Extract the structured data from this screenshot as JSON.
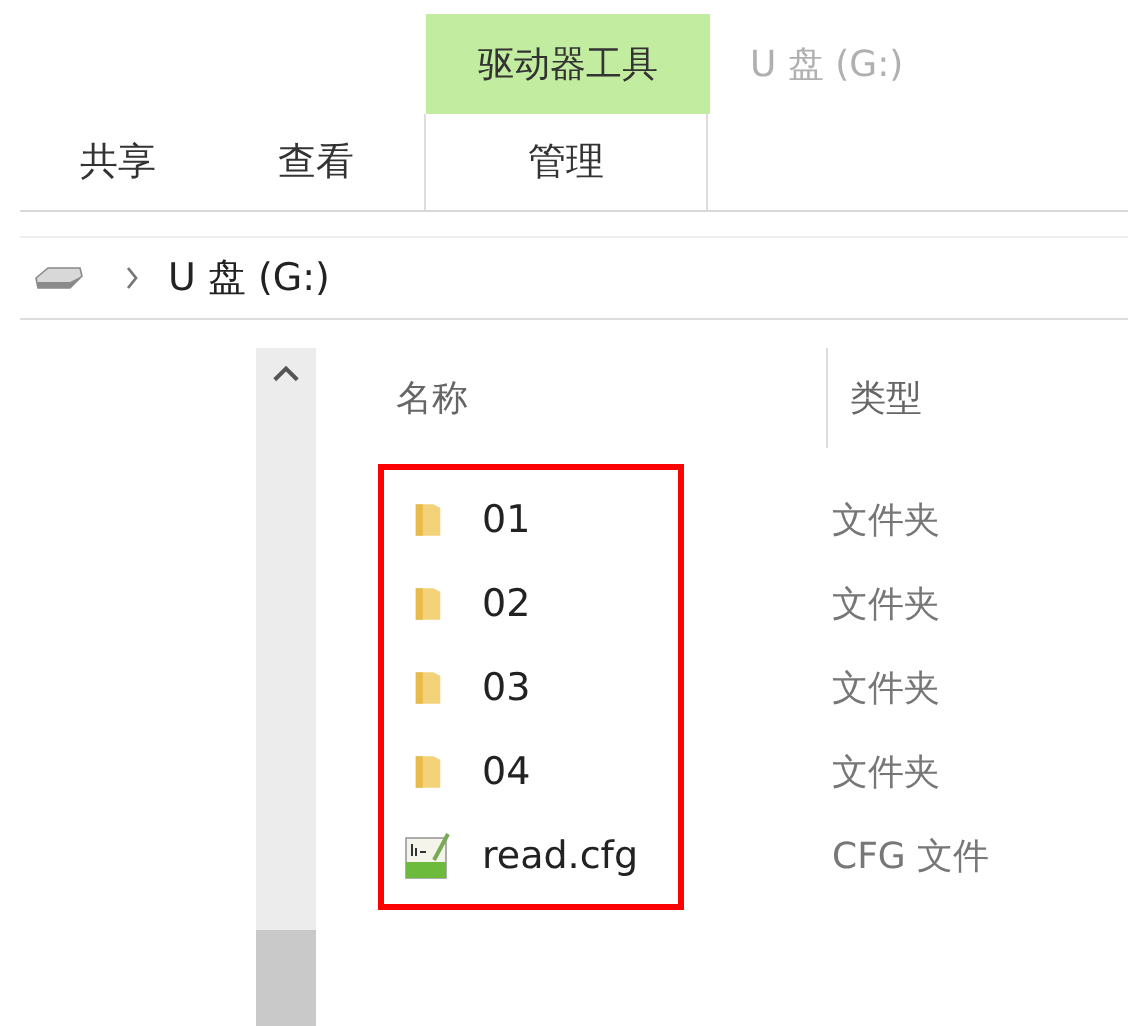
{
  "ribbon": {
    "context_group": "驱动器工具",
    "window_title": "U 盘 (G:)",
    "tabs": [
      {
        "label": "共享",
        "kind": "normal"
      },
      {
        "label": "查看",
        "kind": "normal"
      },
      {
        "label": "管理",
        "kind": "contextual"
      }
    ]
  },
  "address_bar": {
    "path": "U 盘 (G:)"
  },
  "columns": [
    "名称",
    "类型"
  ],
  "files": [
    {
      "name": "01",
      "type": "文件夹",
      "kind": "folder"
    },
    {
      "name": "02",
      "type": "文件夹",
      "kind": "folder"
    },
    {
      "name": "03",
      "type": "文件夹",
      "kind": "folder"
    },
    {
      "name": "04",
      "type": "文件夹",
      "kind": "folder"
    },
    {
      "name": "read.cfg",
      "type": "CFG 文件",
      "kind": "cfg"
    }
  ]
}
